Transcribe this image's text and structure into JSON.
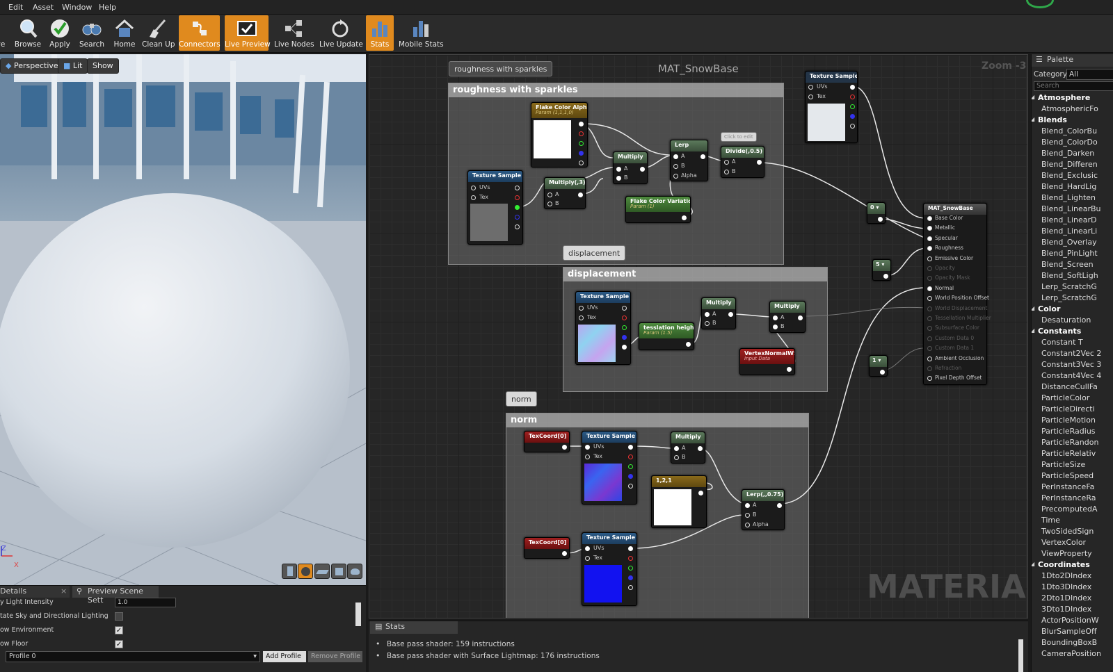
{
  "menu": [
    "Edit",
    "Asset",
    "Window",
    "Help"
  ],
  "toolbar": [
    "ve",
    "Browse",
    "Apply",
    "Search",
    "Home",
    "Clean Up",
    "Connectors",
    "Live Preview",
    "Live Nodes",
    "Live Update",
    "Stats",
    "Mobile Stats"
  ],
  "viewport": {
    "perspective": "Perspective",
    "lit": "Lit",
    "show": "Show",
    "axis_z": "Z",
    "axis_x": "X"
  },
  "details": {
    "tab_details": "Details",
    "tab_preview": "Preview Scene Sett",
    "rows": [
      "y Light Intensity",
      "tate Sky and Directional Lighting",
      "ow Environment",
      "ow Floor"
    ],
    "intensity_value": "1.0",
    "profile_value": "Profile 0",
    "add_profile": "Add Profile",
    "remove_profile": "Remove Profile"
  },
  "graph": {
    "title": "MAT_SnowBase",
    "zoom": "Zoom -3",
    "watermark": "MATERIAL",
    "click_to_edit": "Click to edit"
  },
  "comments": {
    "roughness_bubble": "roughness with sparkles",
    "roughness_title": "roughness with sparkles",
    "displacement_bubble": "displacement",
    "displacement_title": "displacement",
    "norm_bubble": "norm",
    "norm_title": "norm"
  },
  "nodes": {
    "flake_alpha": "Flake Color Alpha",
    "flake_alpha_sub": "Param (1,1,1,0)",
    "tex_rough": "Texture Sample",
    "multiply3": "Multiply(,3)",
    "multiply_r": "Multiply",
    "lerp_r": "Lerp",
    "divide": "Divide(,0.5)",
    "flake_var": "Flake Color Variation",
    "flake_var_sub": "Param (1)",
    "tex_top": "Texture Sample",
    "tex_disp": "Texture Sample",
    "tess": "tesslation height",
    "tess_sub": "Param (1.5)",
    "mult_d1": "Multiply",
    "mult_d2": "Multiply",
    "vnormal": "VertexNormalWS",
    "vnormal_sub": "Input Data",
    "texcoord1": "TexCoord[0]",
    "tex_norm1": "Texture Sample",
    "mult_n": "Multiply",
    "const121": "1,2,1",
    "lerp_n": "Lerp(,,0.75)",
    "texcoord2": "TexCoord[0]",
    "tex_norm2": "Texture Sample",
    "const0": "0",
    "const5": "5",
    "const1": "1",
    "mat": "MAT_SnowBase"
  },
  "pins": {
    "uvs": "UVs",
    "tex": "Tex",
    "a": "A",
    "b": "B",
    "alpha": "Alpha"
  },
  "mat_pins": [
    "Base Color",
    "Metallic",
    "Specular",
    "Roughness",
    "Emissive Color",
    "Opacity",
    "Opacity Mask",
    "Normal",
    "World Position Offset",
    "World Displacement",
    "Tessellation Multiplier",
    "Subsurface Color",
    "Custom Data 0",
    "Custom Data 1",
    "Ambient Occlusion",
    "Refraction",
    "Pixel Depth Offset"
  ],
  "palette": {
    "title": "Palette",
    "category_label": "Category:",
    "category_value": "All",
    "search_placeholder": "Search",
    "entries": [
      {
        "c": "Atmosphere"
      },
      {
        "i": "AtmosphericFo"
      },
      {
        "c": "Blends"
      },
      {
        "i": "Blend_ColorBu"
      },
      {
        "i": "Blend_ColorDo"
      },
      {
        "i": "Blend_Darken"
      },
      {
        "i": "Blend_Differen"
      },
      {
        "i": "Blend_Exclusic"
      },
      {
        "i": "Blend_HardLig"
      },
      {
        "i": "Blend_Lighten"
      },
      {
        "i": "Blend_LinearBu"
      },
      {
        "i": "Blend_LinearD"
      },
      {
        "i": "Blend_LinearLi"
      },
      {
        "i": "Blend_Overlay"
      },
      {
        "i": "Blend_PinLight"
      },
      {
        "i": "Blend_Screen"
      },
      {
        "i": "Blend_SoftLigh"
      },
      {
        "i": "Lerp_ScratchG"
      },
      {
        "i": "Lerp_ScratchG"
      },
      {
        "c": "Color"
      },
      {
        "i": "Desaturation"
      },
      {
        "c": "Constants"
      },
      {
        "i": "Constant       T"
      },
      {
        "i": "Constant2Vec 2"
      },
      {
        "i": "Constant3Vec 3"
      },
      {
        "i": "Constant4Vec 4"
      },
      {
        "i": "DistanceCullFa"
      },
      {
        "i": "ParticleColor"
      },
      {
        "i": "ParticleDirecti"
      },
      {
        "i": "ParticleMotion"
      },
      {
        "i": "ParticleRadius"
      },
      {
        "i": "ParticleRandon"
      },
      {
        "i": "ParticleRelativ"
      },
      {
        "i": "ParticleSize"
      },
      {
        "i": "ParticleSpeed"
      },
      {
        "i": "PerInstanceFa"
      },
      {
        "i": "PerInstanceRa"
      },
      {
        "i": "PrecomputedA"
      },
      {
        "i": "Time"
      },
      {
        "i": "TwoSidedSign"
      },
      {
        "i": "VertexColor"
      },
      {
        "i": "ViewProperty"
      },
      {
        "c": "Coordinates"
      },
      {
        "i": "1Dto2DIndex"
      },
      {
        "i": "1Dto3DIndex"
      },
      {
        "i": "2Dto1DIndex"
      },
      {
        "i": "3Dto1DIndex"
      },
      {
        "i": "ActorPositionW"
      },
      {
        "i": "BlurSampleOff"
      },
      {
        "i": "BoundingBoxB"
      },
      {
        "i": "CameraPosition"
      }
    ]
  },
  "stats": {
    "tab": "Stats",
    "lines": [
      "Base pass shader: 159 instructions",
      "Base pass shader with Surface Lightmap: 176 instructions"
    ]
  },
  "colors": {
    "accent": "#e08a1e",
    "texture_header": "#2b5a86",
    "param_header": "#4e8a3e",
    "input_header": "#a02020"
  }
}
